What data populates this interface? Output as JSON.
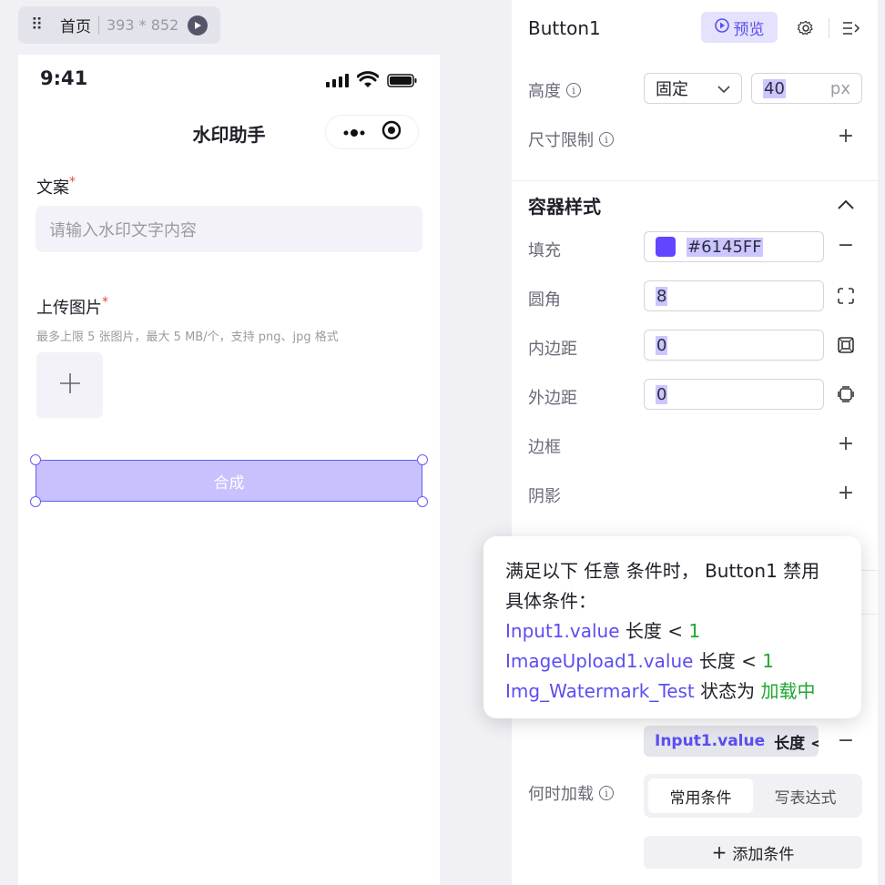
{
  "topbar": {
    "home": "首页",
    "size": "393 * 852"
  },
  "phone": {
    "time": "9:41",
    "app_title": "水印助手",
    "copy_label": "文案",
    "copy_placeholder": "请输入水印文字内容",
    "upload_label": "上传图片",
    "upload_hint": "最多上限 5 张图片，最大 5 MB/个，支持 png、jpg 格式",
    "required_mark": "*",
    "button_label": "合成"
  },
  "panel": {
    "title": "Button1",
    "preview_label": "预览",
    "height_label": "高度",
    "height_mode": "固定",
    "height_value": "40",
    "height_unit": "px",
    "size_limit_label": "尺寸限制",
    "container_style": "容器样式",
    "fill_label": "填充",
    "fill_value": "#6145FF",
    "radius_label": "圆角",
    "radius_value": "8",
    "padding_label": "内边距",
    "padding_value": "0",
    "margin_label": "外边距",
    "margin_value": "0",
    "border_label": "边框",
    "shadow_label": "阴影",
    "chip_var": "Input1.value",
    "chip_op": "长度 <",
    "load_label": "何时加载",
    "seg_common": "常用条件",
    "seg_expr": "写表达式",
    "add_condition": "添加条件"
  },
  "tooltip": {
    "line1a": "满足以下",
    "line1b": "任意",
    "line1c": "条件时，",
    "line1d": "Button1",
    "line1e": "禁用",
    "line2": "具体条件：",
    "c1_var": "Input1.value",
    "c1_op": "长度 <",
    "c1_val": "1",
    "c2_var": "ImageUpload1.value",
    "c2_op": "长度 <",
    "c2_val": "1",
    "c3_var": "Img_Watermark_Test",
    "c3_op": "状态为",
    "c3_val": "加载中"
  },
  "colors": {
    "accent": "#6145FF",
    "button_fill": "#C7C1FE"
  }
}
